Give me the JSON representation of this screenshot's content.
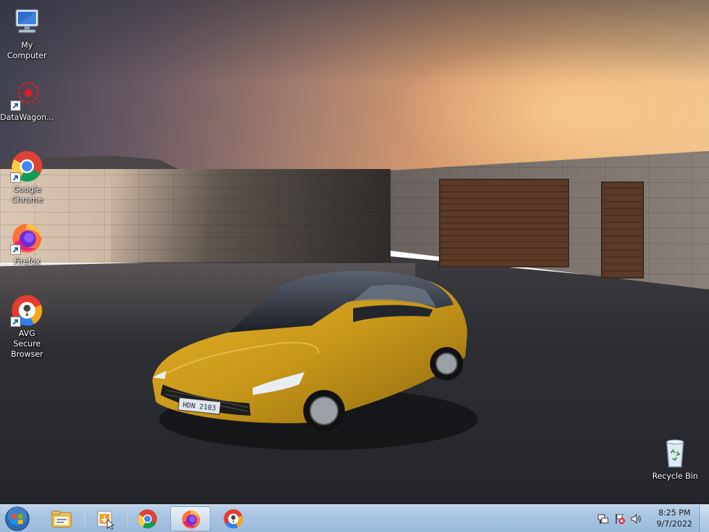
{
  "desktop": {
    "icons": [
      {
        "label": "My Computer",
        "icon": "computer-icon"
      },
      {
        "label": "DataWagon...",
        "icon": "datawagon-icon",
        "shortcut": true
      },
      {
        "label": "Google Chrome",
        "icon": "chrome-icon",
        "shortcut": true
      },
      {
        "label": "Firefox",
        "icon": "firefox-icon",
        "shortcut": true
      },
      {
        "label": "AVG Secure Browser",
        "icon": "avg-browser-icon",
        "shortcut": true
      },
      {
        "label": "Recycle Bin",
        "icon": "recycle-bin-icon"
      }
    ],
    "wallpaper": {
      "plate_text": "HDN 2103",
      "car_color": "#c9981a"
    }
  },
  "taskbar": {
    "start_icon": "windows-start-icon",
    "buttons": [
      {
        "name": "explorer",
        "icon": "folder-icon",
        "active": false
      },
      {
        "name": "installer",
        "icon": "installer-icon",
        "active": false
      },
      {
        "name": "chrome",
        "icon": "chrome-icon",
        "active": false
      },
      {
        "name": "firefox",
        "icon": "firefox-icon",
        "active": true
      },
      {
        "name": "avg",
        "icon": "avg-browser-icon",
        "active": false
      }
    ],
    "tray": [
      "network-icon",
      "action-center-flag-icon",
      "volume-icon"
    ],
    "clock": {
      "time": "8:25 PM",
      "date": "9/7/2022"
    },
    "colors": {
      "taskbar": "#a8c4e2",
      "accent": "#1f5fa8"
    }
  }
}
